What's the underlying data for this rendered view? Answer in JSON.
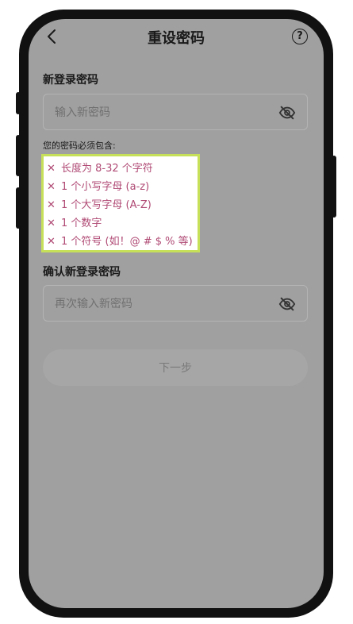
{
  "header": {
    "title": "重设密码",
    "help_label": "?"
  },
  "new_password": {
    "label": "新登录密码",
    "placeholder": "输入新密码"
  },
  "requirements": {
    "title": "您的密码必须包含:",
    "mark": "✕",
    "items": [
      "长度为 8-32 个字符",
      "1 个小写字母 (a-z)",
      "1 个大写字母 (A-Z)",
      "1 个数字",
      "1 个符号 (如！@ # $ % 等)"
    ]
  },
  "confirm_password": {
    "label": "确认新登录密码",
    "placeholder": "再次输入新密码"
  },
  "next_button": {
    "label": "下一步"
  },
  "colors": {
    "overlay": "#a0a0a0",
    "requirement_text": "#b04a74",
    "highlight_border": "#c7e05a"
  }
}
